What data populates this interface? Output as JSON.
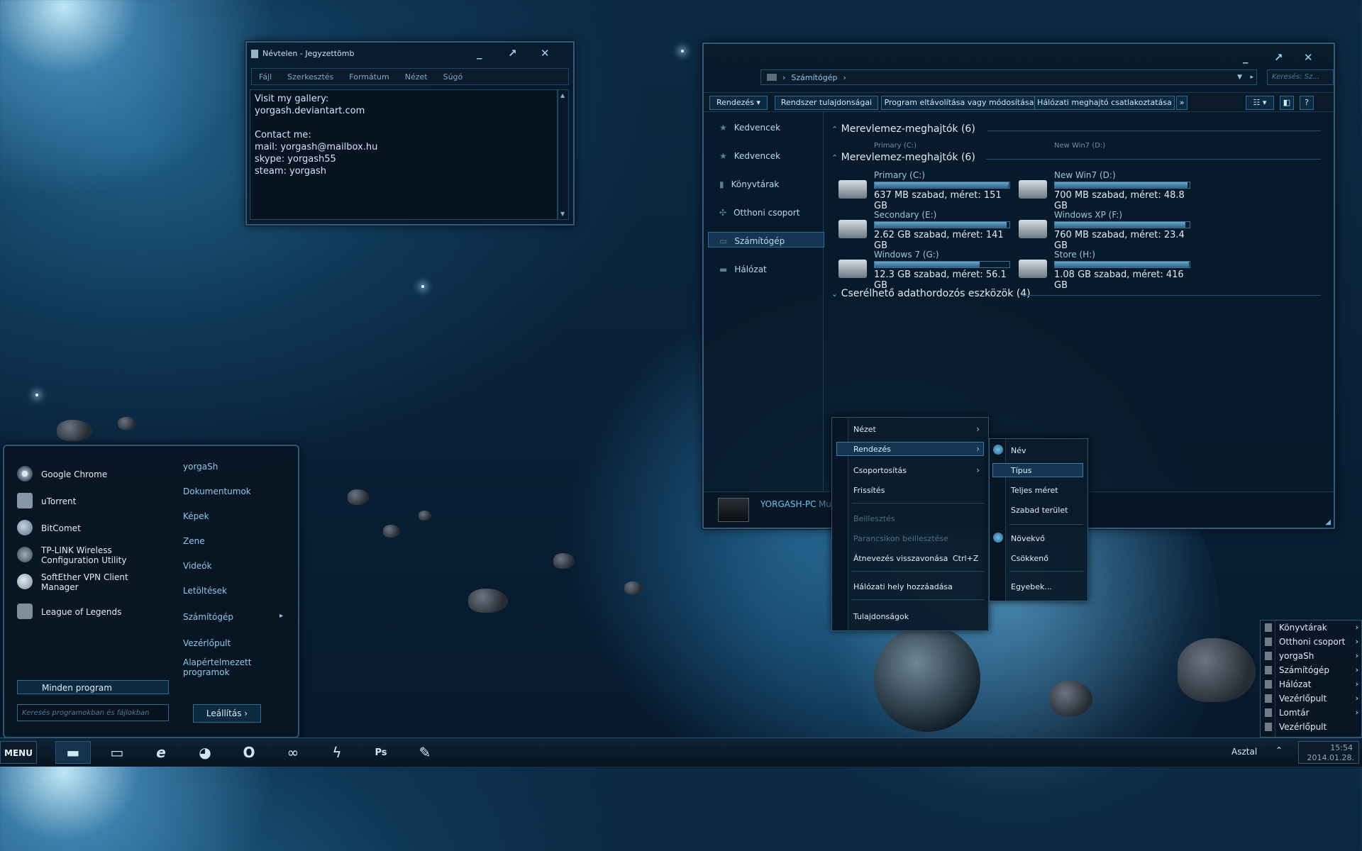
{
  "notepad": {
    "title": "Névtelen - Jegyzettömb",
    "menu": [
      "Fájl",
      "Szerkesztés",
      "Formátum",
      "Nézet",
      "Súgó"
    ],
    "content": "Visit my gallery:\nyorgash.deviantart.com\n\nContact me:\nmail: yorgash@mailbox.hu\nskype: yorgash55\nsteam: yorgash"
  },
  "explorer": {
    "breadcrumb": [
      "Számítógép"
    ],
    "search_placeholder": "Keresés: Sz...",
    "toolbar": {
      "organize": "Rendezés",
      "system_properties": "Rendszer tulajdonságai",
      "uninstall": "Program eltávolítása vagy módosítása",
      "map_drive": "Hálózati meghajtó csatlakoztatása"
    },
    "nav": [
      "Kedvencek",
      "Kedvencek",
      "Könyvtárak",
      "Otthoni csoport",
      "Számítógép",
      "Hálózat"
    ],
    "group_hard_drives": "Merevlemez-meghajtók (6)",
    "group_removable": "Cserélhető adathordozós eszközök (4)",
    "ghost_row": [
      "Primary (C:)",
      "New Win7 (D:)"
    ],
    "drives": [
      {
        "name": "Primary (C:)",
        "info": "637 MB szabad, méret: 151 GB",
        "used": 0.996
      },
      {
        "name": "New Win7 (D:)",
        "info": "700 MB szabad, méret: 48.8 GB",
        "used": 0.986
      },
      {
        "name": "Secondary (E:)",
        "info": "2.62 GB szabad, méret: 141 GB",
        "used": 0.98
      },
      {
        "name": "Windows XP (F:)",
        "info": "760 MB szabad, méret: 23.4 GB",
        "used": 0.97
      },
      {
        "name": "Windows 7 (G:)",
        "info": "12.3 GB szabad, méret: 56.1 GB",
        "used": 0.78
      },
      {
        "name": "Store (H:)",
        "info": "1.08 GB szabad, méret: 416 GB",
        "used": 0.997
      }
    ],
    "status_pc": "YORGASH-PC",
    "status_extra": "Mu"
  },
  "context_menu": {
    "items": [
      "Nézet",
      "Rendezés",
      "Csoportosítás",
      "Frissítés",
      "Beillesztés",
      "Parancsikon beillesztése",
      "Átnevezés visszavonása",
      "Hálózati hely hozzáadása",
      "Tulajdonságok"
    ],
    "undo_shortcut": "Ctrl+Z",
    "submenu": [
      "Név",
      "Típus",
      "Teljes méret",
      "Szabad terület",
      "Növekvő",
      "Csökkenő",
      "Egyebek..."
    ]
  },
  "start_menu": {
    "programs": [
      "Google Chrome",
      "uTorrent",
      "BitComet",
      "TP-LINK Wireless\nConfiguration Utility",
      "SoftEther VPN Client\nManager",
      "League of Legends"
    ],
    "places": [
      "yorgaSh",
      "Dokumentumok",
      "Képek",
      "Zene",
      "Videók",
      "Letöltések",
      "Számítógép",
      "Vezérlőpult",
      "Alapértelmezett\nprogramok"
    ],
    "all_programs": "Minden program",
    "search_placeholder": "Keresés programokban és fájlokban",
    "shutdown": "Leállítás"
  },
  "taskbar": {
    "menu_label": "MENU",
    "desktop_label": "Asztal",
    "time": "15:54",
    "date": "2014.01.28."
  },
  "jump_list": [
    "Könyvtárak",
    "Otthoni csoport",
    "yorgaSh",
    "Számítógép",
    "Hálózat",
    "Vezérlőpult",
    "Lomtár",
    "Vezérlőpult"
  ]
}
